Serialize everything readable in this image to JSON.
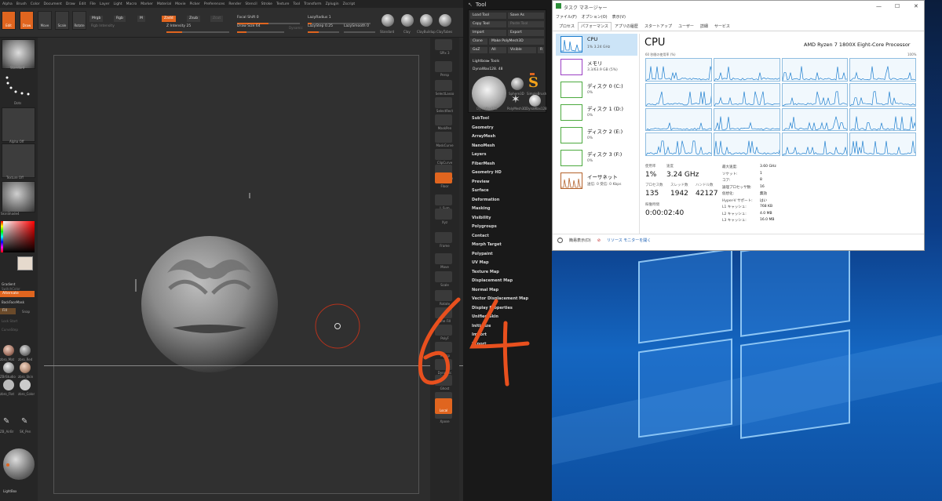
{
  "zbrush": {
    "menu": [
      "Alpha",
      "Brush",
      "Color",
      "Document",
      "Draw",
      "Edit",
      "File",
      "Layer",
      "Light",
      "Macro",
      "Marker",
      "Material",
      "Movie",
      "Picker",
      "Preferences",
      "Render",
      "Stencil",
      "Stroke",
      "Texture",
      "Tool",
      "Transform",
      "Zplugin",
      "Zscript"
    ],
    "top_buttons": [
      "Edit",
      "Draw",
      "Move",
      "Scale",
      "Rotate"
    ],
    "mrgb": "Mrgb",
    "rgb": "Rgb",
    "m": "M",
    "rgb_intensity": "Rgb Intensity",
    "zadd": "Zadd",
    "zsub": "Zsub",
    "zcut": "Zcut",
    "z_intensity": "Z Intensity 25",
    "focal_shift": "Focal Shift 0",
    "draw_size": "Draw Size 64",
    "dynamic": "Dynamic",
    "lazy_radius": "LazyRadius 1",
    "lazy_step": "LazyStep 0.25",
    "lazy_smooth": "LazySmooth 0",
    "brush_shelf": [
      "Standard",
      "Clay",
      "ClayBuildup",
      "ClayTubes"
    ],
    "left": {
      "brush_label": "Standard",
      "dots_label": "Dots",
      "alpha_label": "Alpha Off",
      "texture_label": "Texture Off",
      "material_label": "SkinShade4",
      "gradient": "Gradient",
      "switch_color": "SwitchColor",
      "alternate": "Alternate",
      "backface": "BackFaceMask",
      "fill": "Fill",
      "snap": "Snap",
      "lock_start": "Lock Start",
      "curve_step": "CurveStep",
      "material_thumbs": [
        "zbro_Mat",
        "zbro_Red",
        "ZBrStudio",
        "zbro_Skin",
        "zbro_Flat",
        "zbro_Color"
      ],
      "brush_thumbs": [
        "ZB_AirBr",
        "SK_Pen"
      ],
      "lightbox": "LightBox"
    },
    "right_shelf": [
      "SPix 3",
      "Persp",
      "SelectLasso",
      "SelectRect",
      "MaskPen",
      "MaskCurve",
      "ClipCurve",
      "SliceCurve",
      "Floor",
      "L.Sym",
      "Xyz",
      "Frame",
      "Move",
      "Scale",
      "Rotate",
      "Line Fill",
      "PolyF",
      "Transp",
      "Dynamic",
      "Ghost",
      "Solo",
      "Xpose"
    ],
    "local": "Local",
    "tool_panel": {
      "title": "Tool",
      "buttons": [
        "Load Tool",
        "Save As",
        "Copy Tool",
        "Paste Tool",
        "Import",
        "Export",
        "Clone",
        "Make PolyMesh3D",
        "GoZ",
        "All",
        "Visible",
        "R"
      ],
      "lightbox_tools": "Lightbox▸ Tools",
      "current_tool": "DynaWax128. 48",
      "thumb_labels": [
        "DynaWax128",
        "Sphere3D",
        "SimpleBrush",
        "PolyMesh3D",
        "DynaWax128"
      ],
      "menu": [
        "SubTool",
        "Geometry",
        "ArrayMesh",
        "NanoMesh",
        "Layers",
        "FiberMesh",
        "Geometry HD",
        "Preview",
        "Surface",
        "Deformation",
        "Masking",
        "Visibility",
        "Polygroups",
        "Contact",
        "Morph Target",
        "Polypaint",
        "UV Map",
        "Texture Map",
        "Displacement Map",
        "Normal Map",
        "Vector Displacement Map",
        "Display Properties",
        "Unified Skin",
        "Initialize",
        "Import",
        "Export"
      ]
    },
    "annotation": "64"
  },
  "task_manager": {
    "title": "タスク マネージャー",
    "menu": [
      "ファイル(F)",
      "オプション(O)",
      "表示(V)"
    ],
    "tabs": [
      "プロセス",
      "パフォーマンス",
      "アプリの履歴",
      "スタートアップ",
      "ユーザー",
      "詳細",
      "サービス"
    ],
    "active_tab": "パフォーマンス",
    "sidebar": [
      {
        "title": "CPU",
        "sub": "1%  3.24 GHz",
        "color": "#1f7fcf"
      },
      {
        "title": "メモリ",
        "sub": "3.3/63.9 GB (5%)",
        "color": "#9b3fc4"
      },
      {
        "title": "ディスク 0 (C:)",
        "sub": "0%",
        "color": "#4caa3f"
      },
      {
        "title": "ディスク 1 (D:)",
        "sub": "0%",
        "color": "#4caa3f"
      },
      {
        "title": "ディスク 2 (E:)",
        "sub": "0%",
        "color": "#4caa3f"
      },
      {
        "title": "ディスク 3 (F:)",
        "sub": "0%",
        "color": "#4caa3f"
      },
      {
        "title": "イーサネット",
        "sub": "送信: 0 受信: 0 Kbps",
        "color": "#b3612a"
      }
    ],
    "cpu_title": "CPU",
    "cpu_name": "AMD Ryzen 7 1800X Eight-Core Processor",
    "graph_caption": "60 秒間の使用率 (%)",
    "graph_max": "100%",
    "stats": {
      "usage_label": "使用率",
      "usage": "1%",
      "speed_label": "速度",
      "speed": "3.24 GHz",
      "proc_label": "プロセス数",
      "proc": "135",
      "thread_label": "スレッド数",
      "thread": "1942",
      "handle_label": "ハンドル数",
      "handle": "42127",
      "uptime_label": "稼働時間",
      "uptime": "0:00:02:40"
    },
    "details": [
      [
        "最大速度:",
        "3.60 GHz"
      ],
      [
        "ソケット:",
        "1"
      ],
      [
        "コア:",
        "8"
      ],
      [
        "論理プロセッサ数:",
        "16"
      ],
      [
        "仮想化:",
        "無効"
      ],
      [
        "Hyper-V サポート:",
        "はい"
      ],
      [
        "L1 キャッシュ:",
        "768 KB"
      ],
      [
        "L2 キャッシュ:",
        "4.0 MB"
      ],
      [
        "L3 キャッシュ:",
        "16.0 MB"
      ]
    ],
    "fewer_details": "簡易表示(D)",
    "resource_monitor": "リソース モニターを開く"
  },
  "colors": {
    "zbrush_accent": "#e0651f",
    "cpu_graph": "#1f7fcf",
    "annotation": "#e8501e"
  }
}
